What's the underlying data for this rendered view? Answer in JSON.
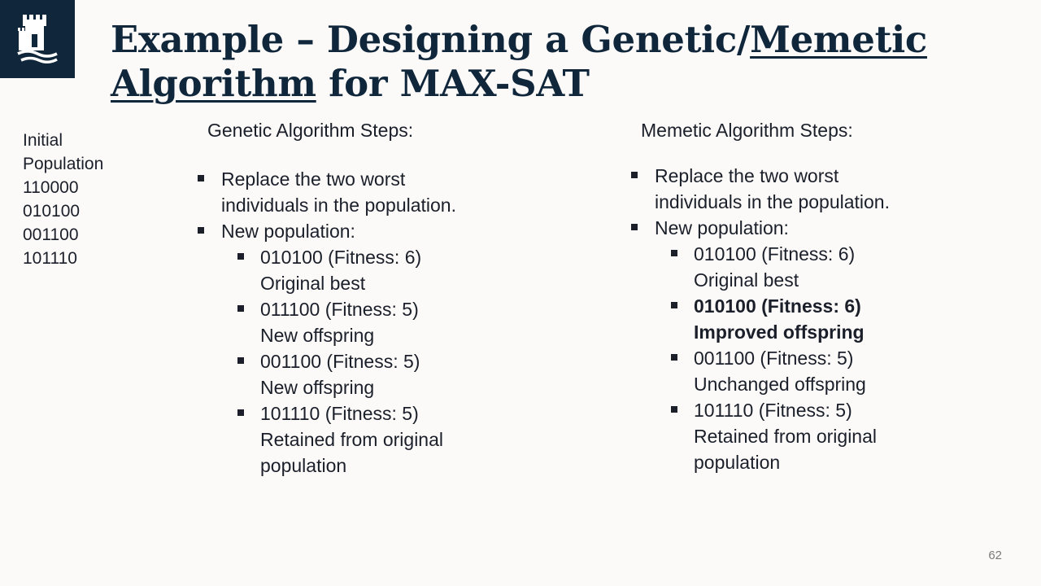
{
  "title": {
    "part1": "Example – Designing a Genetic/",
    "part2": "Memetic",
    "part3": "Algorithm",
    "part4": " for MAX-SAT"
  },
  "initial_population": {
    "label_line1": "Initial",
    "label_line2": "Population",
    "items": [
      "110000",
      "010100",
      "001100",
      "101110"
    ]
  },
  "genetic": {
    "heading": "Genetic Algorithm Steps:",
    "bullet1_line1": "Replace the two worst",
    "bullet1_line2": "individuals in the population.",
    "bullet2": "New population:",
    "entries": [
      {
        "line1": "010100 (Fitness: 6)",
        "line2": "Original best"
      },
      {
        "line1": "011100 (Fitness: 5)",
        "line2": "New offspring"
      },
      {
        "line1": "001100 (Fitness: 5)",
        "line2": "New offspring"
      },
      {
        "line1": "101110 (Fitness: 5)",
        "line2": "Retained from original",
        "line3": "population"
      }
    ]
  },
  "memetic": {
    "heading": "Memetic Algorithm Steps:",
    "bullet1_line1": "Replace the two worst",
    "bullet1_line2": "individuals in the population.",
    "bullet2": "New population:",
    "entries": [
      {
        "line1": "010100 (Fitness: 6)",
        "line2": "Original best"
      },
      {
        "line1": "010100 (Fitness: 6)",
        "line2": "Improved offspring",
        "bold": true
      },
      {
        "line1": "001100 (Fitness: 5)",
        "line2": "Unchanged offspring"
      },
      {
        "line1": "101110 (Fitness: 5)",
        "line2": "Retained from original",
        "line3": "population"
      }
    ]
  },
  "page_number": "62",
  "colors": {
    "brand_navy": "#10263b",
    "background": "#fbfaf8",
    "text": "#1b1f2a"
  }
}
